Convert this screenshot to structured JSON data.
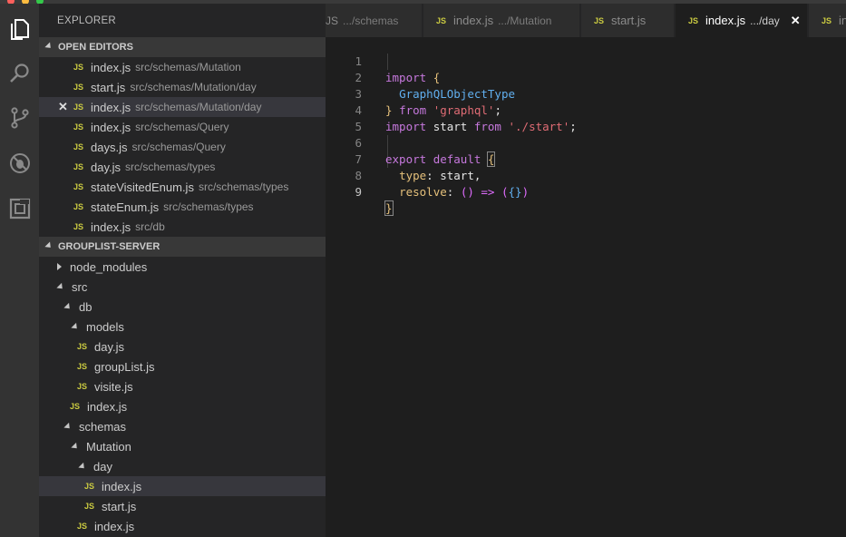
{
  "sidebar": {
    "title": "EXPLORER",
    "open_editors": {
      "header": "OPEN EDITORS",
      "items": [
        {
          "name": "index.js",
          "path": "src/schemas/Mutation"
        },
        {
          "name": "start.js",
          "path": "src/schemas/Mutation/day"
        },
        {
          "name": "index.js",
          "path": "src/schemas/Mutation/day",
          "close": "✕"
        },
        {
          "name": "index.js",
          "path": "src/schemas/Query"
        },
        {
          "name": "days.js",
          "path": "src/schemas/Query"
        },
        {
          "name": "day.js",
          "path": "src/schemas/types"
        },
        {
          "name": "stateVisitedEnum.js",
          "path": "src/schemas/types"
        },
        {
          "name": "stateEnum.js",
          "path": "src/schemas/types"
        },
        {
          "name": "index.js",
          "path": "src/db"
        }
      ]
    },
    "project": {
      "header": "GROUPLIST-SERVER",
      "tree": [
        {
          "label": "node_modules",
          "kind": "folder-closed"
        },
        {
          "label": "src",
          "kind": "folder-open"
        },
        {
          "label": "db",
          "kind": "folder-open"
        },
        {
          "label": "models",
          "kind": "folder-open"
        },
        {
          "label": "day.js",
          "kind": "file"
        },
        {
          "label": "groupList.js",
          "kind": "file"
        },
        {
          "label": "visite.js",
          "kind": "file"
        },
        {
          "label": "index.js",
          "kind": "file"
        },
        {
          "label": "schemas",
          "kind": "folder-open"
        },
        {
          "label": "Mutation",
          "kind": "folder-open"
        },
        {
          "label": "day",
          "kind": "folder-open"
        },
        {
          "label": "index.js",
          "kind": "file"
        },
        {
          "label": "start.js",
          "kind": "file"
        },
        {
          "label": "index.js",
          "kind": "file"
        }
      ]
    },
    "js_badge": "JS"
  },
  "tabs": [
    {
      "name": "",
      "path": ".../schemas"
    },
    {
      "name": "index.js",
      "path": ".../Mutation"
    },
    {
      "name": "start.js",
      "path": ""
    },
    {
      "name": "index.js",
      "path": ".../day",
      "close": "✕"
    },
    {
      "name": "in",
      "path": ""
    }
  ],
  "editor": {
    "line_numbers": [
      "1",
      "2",
      "3",
      "4",
      "5",
      "6",
      "7",
      "8",
      "9"
    ],
    "code": {
      "l1_kw": "import",
      "l1_brace": "{",
      "l2_type": "GraphQLObjectType",
      "l3_brace": "}",
      "l3_from": "from",
      "l3_str": "'graphql'",
      "l3_semi": ";",
      "l4_import": "import",
      "l4_var": "start",
      "l4_from": "from",
      "l4_str": "'./start'",
      "l4_semi": ";",
      "l6_export": "export",
      "l6_default": "default",
      "l6_brace": "{",
      "l7_prop": "type",
      "l7_colon": ":",
      "l7_val": "start",
      "l7_comma": ",",
      "l8_prop": "resolve",
      "l8_colon": ":",
      "l8_parens": "()",
      "l8_arrow": "=>",
      "l8_open": "(",
      "l8_braces": "{}",
      "l8_close": ")",
      "l9_brace": "}"
    }
  },
  "icons": {
    "files": "files-icon",
    "search": "search-icon",
    "scm": "source-control-icon",
    "debug": "debug-icon",
    "extensions": "extensions-icon"
  },
  "colors": {
    "activity_bar": "#333333",
    "sidebar": "#252526",
    "editor": "#1e1e1e",
    "js_badge": "#cbcb41"
  }
}
